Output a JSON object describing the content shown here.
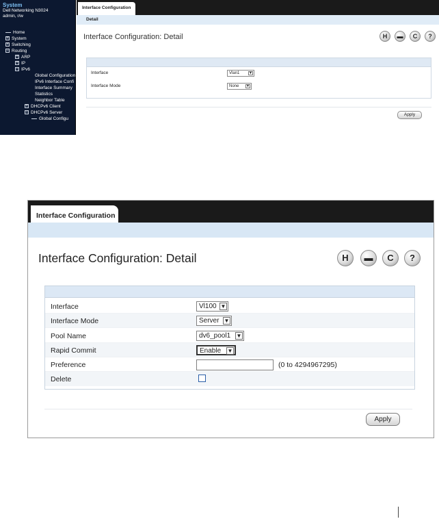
{
  "screenshot_small": {
    "nav": {
      "system_title": "System",
      "device_name": "Dell Networking N3024",
      "user": "admin, r/w",
      "items": [
        {
          "label": "Home",
          "marker": "dash"
        },
        {
          "label": "System",
          "marker": "+"
        },
        {
          "label": "Switching",
          "marker": "+"
        },
        {
          "label": "Routing",
          "marker": "-"
        },
        {
          "label": "ARP",
          "marker": "+"
        },
        {
          "label": "IP",
          "marker": "+"
        },
        {
          "label": "IPv6",
          "marker": "-"
        },
        {
          "label": "Global Configuration",
          "marker": "none"
        },
        {
          "label": "IPv6 Interface Confi",
          "marker": "none"
        },
        {
          "label": "Interface Summary",
          "marker": "none"
        },
        {
          "label": "Statistics",
          "marker": "none"
        },
        {
          "label": "Neighbor Table",
          "marker": "none"
        },
        {
          "label": "DHCPv6 Client",
          "marker": "+"
        },
        {
          "label": "DHCPv6 Server",
          "marker": "-"
        },
        {
          "label": "Global Configu",
          "marker": "line"
        }
      ]
    },
    "tab_label": "Interface Configuration",
    "subtab_label": "Detail",
    "page_title": "Interface Configuration: Detail",
    "icons": [
      "save-icon",
      "print-icon",
      "refresh-icon",
      "help-icon"
    ],
    "fields": [
      {
        "label": "Interface",
        "value": "Vlan1"
      },
      {
        "label": "Interface Mode",
        "value": "None"
      }
    ],
    "apply_label": "Apply"
  },
  "screenshot_large": {
    "tab_label": "Interface Configuration",
    "page_title": "Interface Configuration: Detail",
    "icons": [
      "save-icon",
      "print-icon",
      "refresh-icon",
      "help-icon"
    ],
    "fields": [
      {
        "label": "Interface",
        "value": "Vl100"
      },
      {
        "label": "Interface Mode",
        "value": "Server"
      },
      {
        "label": "Pool Name",
        "value": "dv6_pool1"
      },
      {
        "label": "Rapid Commit",
        "value": "Enable"
      },
      {
        "label": "Preference",
        "value": "",
        "hint": "(0 to 4294967295)"
      },
      {
        "label": "Delete",
        "checked": false
      }
    ],
    "apply_label": "Apply"
  }
}
